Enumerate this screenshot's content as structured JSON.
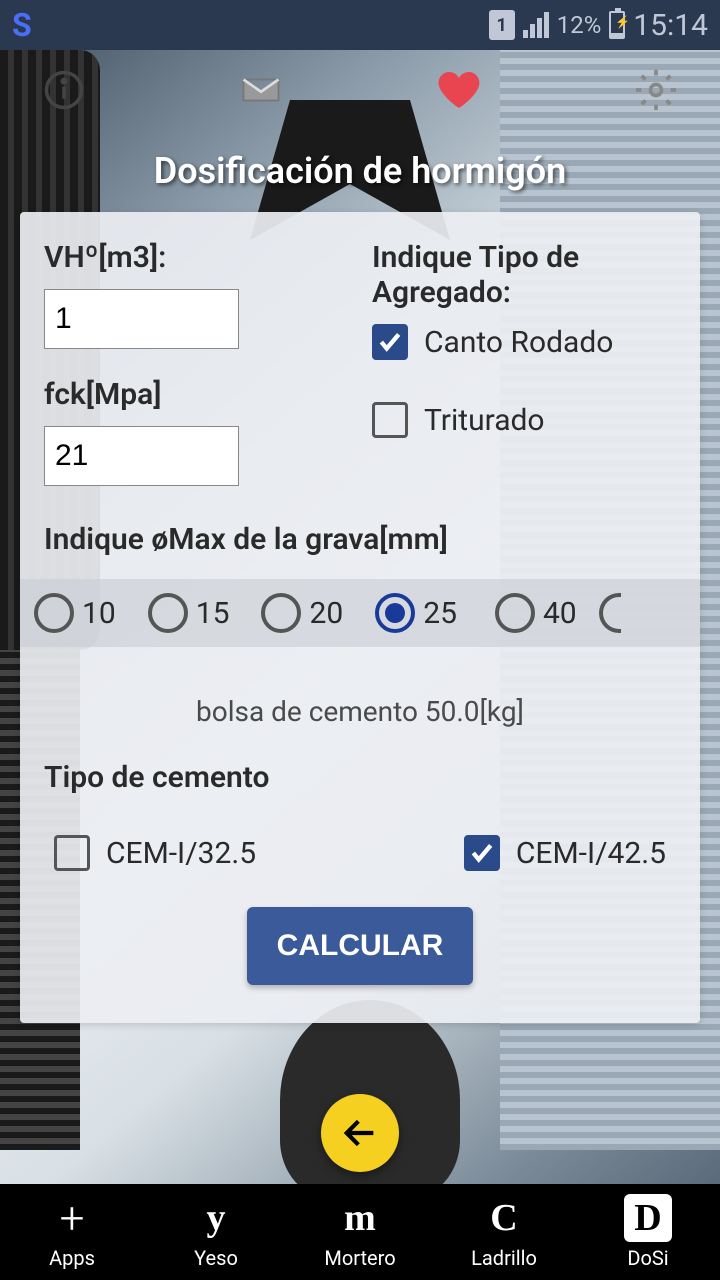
{
  "status": {
    "sim": "1",
    "battery": "12%",
    "time": "15:14"
  },
  "page": {
    "title": "Dosificación de hormigón"
  },
  "form": {
    "vh_label": "VHº[m3]:",
    "vh_value": "1",
    "fck_label": "fck[Mpa]",
    "fck_value": "21",
    "aggregate_label": "Indique Tipo de Agregado:",
    "canto_rodado": "Canto Rodado",
    "triturado": "Triturado",
    "grava_label": "Indique øMax de la grava[mm]",
    "grava_options": [
      "10",
      "15",
      "20",
      "25",
      "40"
    ],
    "grava_selected": "25",
    "bag_hint": "bolsa de cemento 50.0[kg]",
    "cement_label": "Tipo de cemento",
    "cement_options": [
      "CEM-I/32.5",
      "CEM-I/42.5"
    ],
    "calculate": "CALCULAR"
  },
  "nav": {
    "items": [
      {
        "label": "Apps"
      },
      {
        "label": "Yeso"
      },
      {
        "label": "Mortero"
      },
      {
        "label": "Ladrillo"
      },
      {
        "label": "DoSi"
      }
    ]
  }
}
